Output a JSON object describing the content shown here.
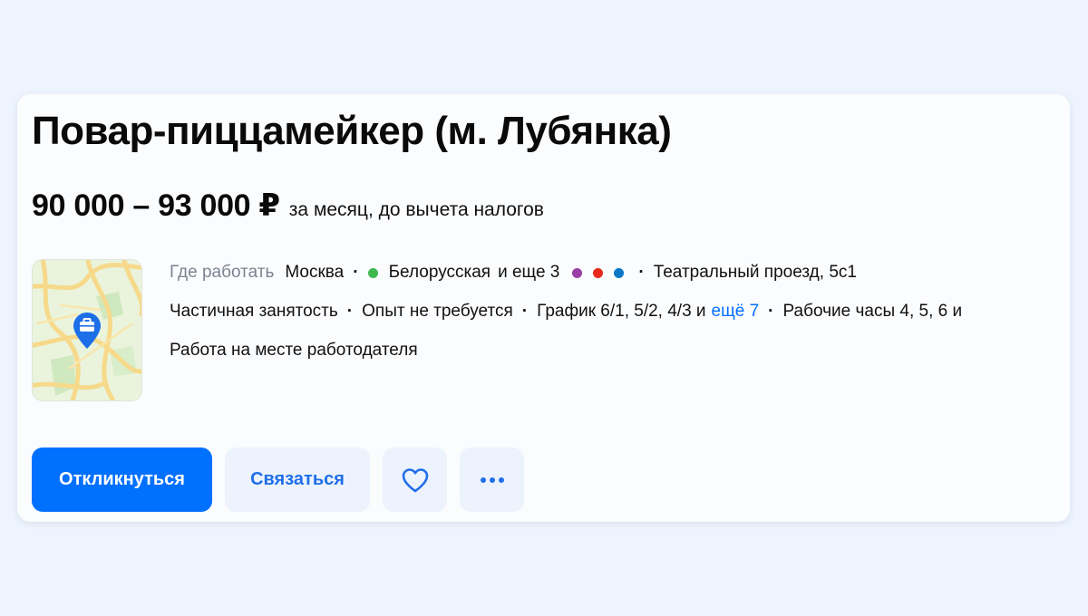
{
  "vacancy": {
    "title": "Повар-пиццамейкер (м. Лубянка)",
    "salary": {
      "amount": "90 000 – 93 000 ₽",
      "note": "за месяц, до вычета налогов"
    }
  },
  "location": {
    "label": "Где работать",
    "city": "Москва",
    "metro_station": "Белорусская",
    "metro_station_color": "#3fb950",
    "more_stations": "и еще 3",
    "more_station_colors": [
      "#9b3fa6",
      "#e8291c",
      "#0a78c7"
    ],
    "address": "Театральный проезд, 5с1"
  },
  "conditions": {
    "employment": "Частичная занятость",
    "experience": "Опыт не требуется",
    "schedule": "График 6/1, 5/2, 4/3 и",
    "schedule_more_link": "ещё 7",
    "hours": "Рабочие часы 4, 5, 6 и",
    "work_format": "Работа на месте работодателя"
  },
  "actions": {
    "respond_label": "Откликнуться",
    "contact_label": "Связаться",
    "favorite_icon": "heart-icon",
    "more_icon": "more-dots-icon"
  },
  "colors": {
    "accent": "#0070ff",
    "secondary_button_bg": "#edf3fd",
    "page_bg": "#eef4fd"
  }
}
